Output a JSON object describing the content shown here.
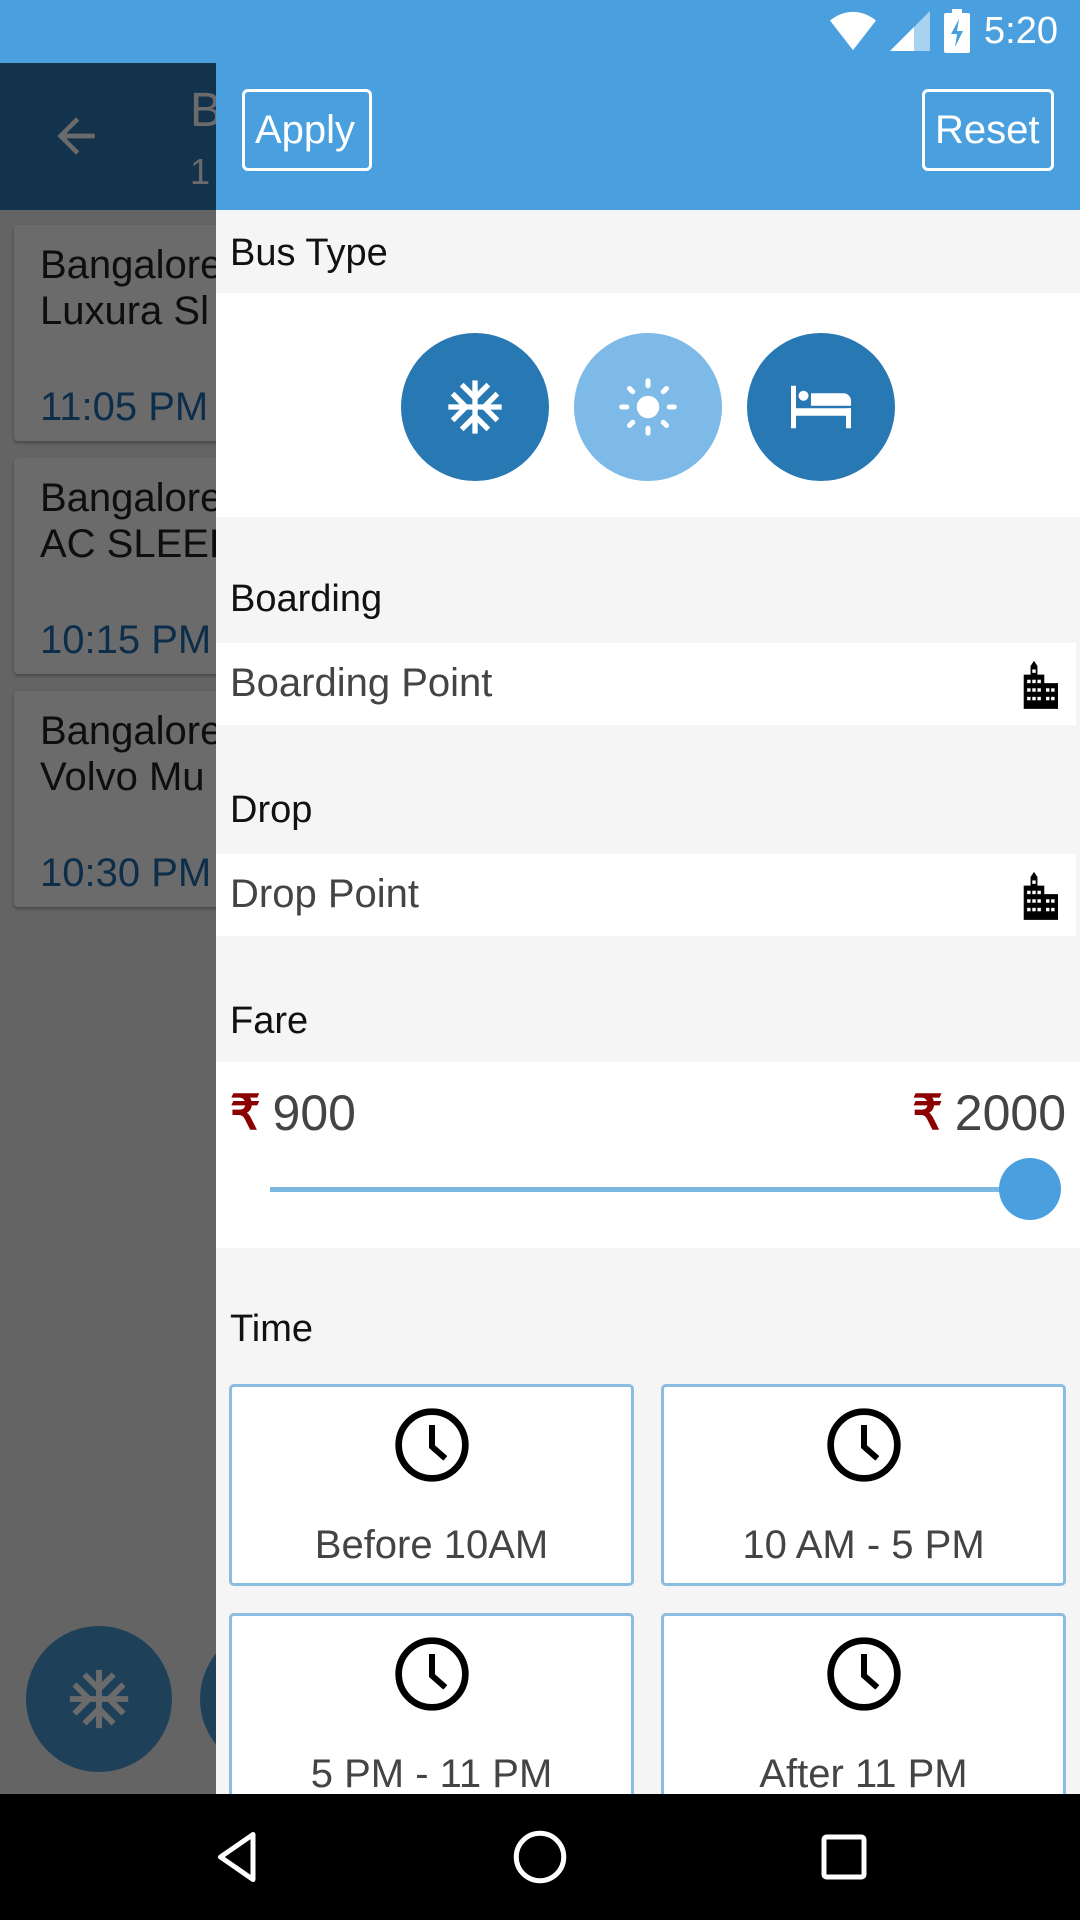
{
  "status_bar": {
    "time": "5:20",
    "icons": [
      "wifi-icon",
      "cell-signal-icon",
      "battery-charging-icon"
    ]
  },
  "background_screen": {
    "toolbar": {
      "back_icon": "arrow-back-icon",
      "title_partial": "B",
      "subtitle_partial": "1"
    },
    "bus_list": [
      {
        "line1": "Bangalore",
        "line2": "Luxura Sl",
        "time": "11:05 PM"
      },
      {
        "line1": "Bangalore",
        "line2": "AC SLEEP",
        "time": "10:15 PM"
      },
      {
        "line1": "Bangalore",
        "line2": "Volvo Mu",
        "time": "10:30 PM"
      }
    ],
    "fab_icons": [
      "snowflake-icon",
      "sun-icon"
    ]
  },
  "filter_drawer": {
    "header": {
      "apply_label": "Apply",
      "reset_label": "Reset"
    },
    "bus_type": {
      "label": "Bus Type",
      "options": [
        {
          "name": "AC",
          "icon": "snowflake-icon",
          "selected": true
        },
        {
          "name": "Non-AC",
          "icon": "sun-icon",
          "selected": false
        },
        {
          "name": "Sleeper",
          "icon": "bed-icon",
          "selected": true
        }
      ]
    },
    "boarding": {
      "label": "Boarding",
      "placeholder": "Boarding Point",
      "icon": "building-icon"
    },
    "drop": {
      "label": "Drop",
      "placeholder": "Drop Point",
      "icon": "building-icon"
    },
    "fare": {
      "label": "Fare",
      "currency_symbol": "₹",
      "min_value": "900",
      "max_value": "2000",
      "slider_position_fraction": 1.0
    },
    "time": {
      "label": "Time",
      "options": [
        {
          "label": "Before 10AM",
          "icon": "clock-icon"
        },
        {
          "label": "10 AM - 5 PM",
          "icon": "clock-icon"
        },
        {
          "label": "5 PM - 11 PM",
          "icon": "clock-icon"
        },
        {
          "label": "After 11 PM",
          "icon": "clock-icon"
        }
      ]
    }
  },
  "colors": {
    "primary": "#4aa0df",
    "selected_bus_type": "#2878b4",
    "unselected_bus_type": "#7dbae8",
    "rupee": "#8b0000",
    "card_border": "#8abde0"
  },
  "nav_bar": {
    "buttons": [
      "back-nav-icon",
      "home-nav-icon",
      "recents-nav-icon"
    ]
  }
}
